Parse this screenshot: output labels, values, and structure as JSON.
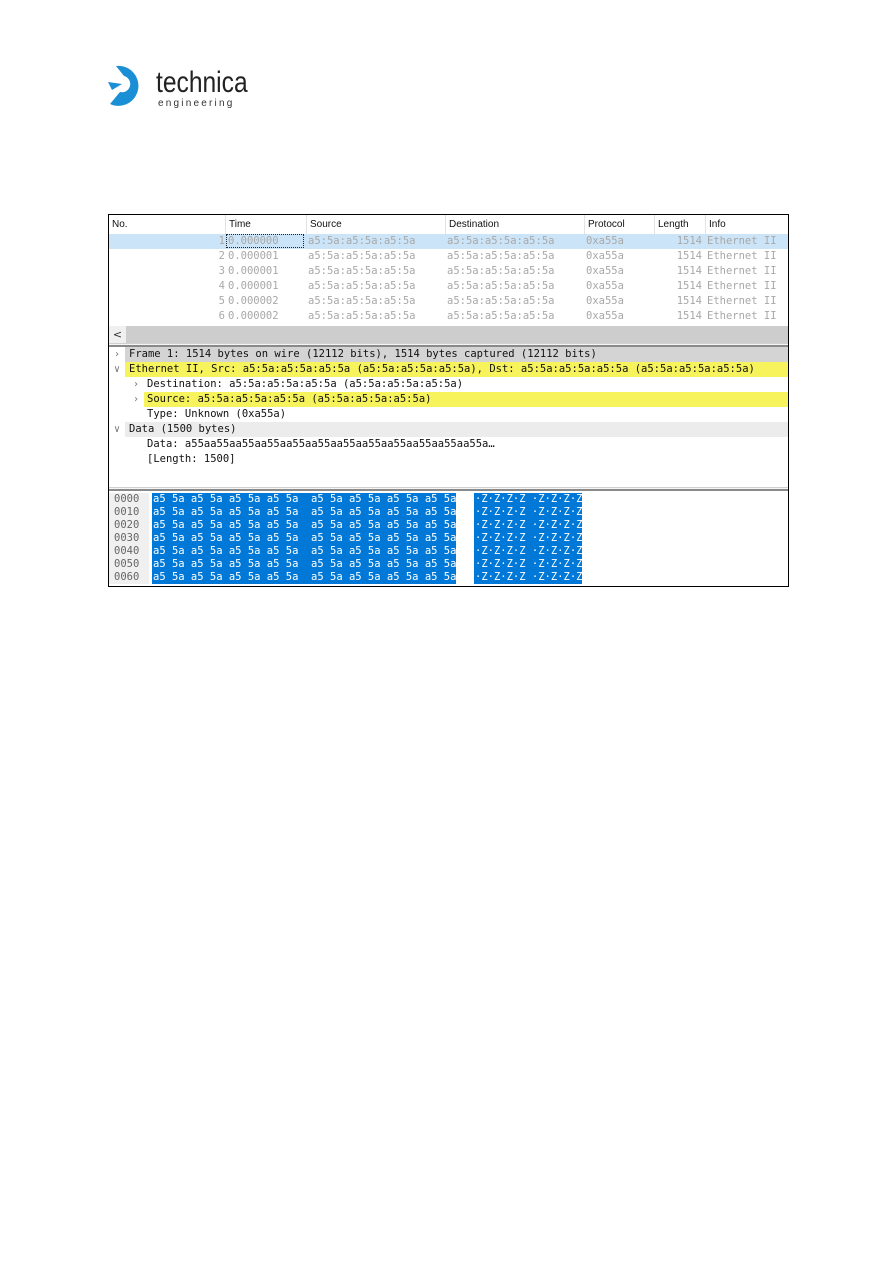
{
  "logo": {
    "word": "technica",
    "sub": "engineering",
    "brand_color": "#1a8fd6"
  },
  "packet_list": {
    "columns": [
      "No.",
      "Time",
      "Source",
      "Destination",
      "Protocol",
      "Length",
      "Info"
    ],
    "rows": [
      {
        "no": "1",
        "time": "0.000000",
        "source": "a5:5a:a5:5a:a5:5a",
        "destination": "a5:5a:a5:5a:a5:5a",
        "protocol": "0xa55a",
        "length": "1514",
        "info": "Ethernet II"
      },
      {
        "no": "2",
        "time": "0.000001",
        "source": "a5:5a:a5:5a:a5:5a",
        "destination": "a5:5a:a5:5a:a5:5a",
        "protocol": "0xa55a",
        "length": "1514",
        "info": "Ethernet II"
      },
      {
        "no": "3",
        "time": "0.000001",
        "source": "a5:5a:a5:5a:a5:5a",
        "destination": "a5:5a:a5:5a:a5:5a",
        "protocol": "0xa55a",
        "length": "1514",
        "info": "Ethernet II"
      },
      {
        "no": "4",
        "time": "0.000001",
        "source": "a5:5a:a5:5a:a5:5a",
        "destination": "a5:5a:a5:5a:a5:5a",
        "protocol": "0xa55a",
        "length": "1514",
        "info": "Ethernet II"
      },
      {
        "no": "5",
        "time": "0.000002",
        "source": "a5:5a:a5:5a:a5:5a",
        "destination": "a5:5a:a5:5a:a5:5a",
        "protocol": "0xa55a",
        "length": "1514",
        "info": "Ethernet II"
      },
      {
        "no": "6",
        "time": "0.000002",
        "source": "a5:5a:a5:5a:a5:5a",
        "destination": "a5:5a:a5:5a:a5:5a",
        "protocol": "0xa55a",
        "length": "1514",
        "info": "Ethernet II"
      }
    ],
    "selected_row": 1,
    "scroll_left_icon": "<"
  },
  "details": {
    "items": [
      {
        "arrow": ">",
        "text": "Frame 1: 1514 bytes on wire (12112 bits), 1514 bytes captured (12112 bits)"
      },
      {
        "arrow": "v",
        "text": "Ethernet II, Src: a5:5a:a5:5a:a5:5a (a5:5a:a5:5a:a5:5a), Dst: a5:5a:a5:5a:a5:5a (a5:5a:a5:5a:a5:5a)"
      },
      {
        "arrow": ">",
        "text": "Destination: a5:5a:a5:5a:a5:5a (a5:5a:a5:5a:a5:5a)"
      },
      {
        "arrow": ">",
        "text": "Source: a5:5a:a5:5a:a5:5a (a5:5a:a5:5a:a5:5a)"
      },
      {
        "arrow": "",
        "text": "Type: Unknown (0xa55a)"
      },
      {
        "arrow": "v",
        "text": "Data (1500 bytes)"
      },
      {
        "arrow": "",
        "text": "Data: a55aa55aa55aa55aa55aa55aa55aa55aa55aa55aa55aa55a…"
      },
      {
        "arrow": "",
        "text": "[Length: 1500]"
      }
    ],
    "highlight_colors": {
      "frame": "#d4d4d4",
      "ethernet": "#f7f35c",
      "source": "#f7f35c",
      "data": "#ececec"
    }
  },
  "bytes": {
    "rows": [
      {
        "offset": "0000",
        "hex": "a5 5a a5 5a a5 5a a5 5a  a5 5a a5 5a a5 5a a5 5a",
        "ascii": "·Z·Z·Z·Z ·Z·Z·Z·Z"
      },
      {
        "offset": "0010",
        "hex": "a5 5a a5 5a a5 5a a5 5a  a5 5a a5 5a a5 5a a5 5a",
        "ascii": "·Z·Z·Z·Z ·Z·Z·Z·Z"
      },
      {
        "offset": "0020",
        "hex": "a5 5a a5 5a a5 5a a5 5a  a5 5a a5 5a a5 5a a5 5a",
        "ascii": "·Z·Z·Z·Z ·Z·Z·Z·Z"
      },
      {
        "offset": "0030",
        "hex": "a5 5a a5 5a a5 5a a5 5a  a5 5a a5 5a a5 5a a5 5a",
        "ascii": "·Z·Z·Z·Z ·Z·Z·Z·Z"
      },
      {
        "offset": "0040",
        "hex": "a5 5a a5 5a a5 5a a5 5a  a5 5a a5 5a a5 5a a5 5a",
        "ascii": "·Z·Z·Z·Z ·Z·Z·Z·Z"
      },
      {
        "offset": "0050",
        "hex": "a5 5a a5 5a a5 5a a5 5a  a5 5a a5 5a a5 5a a5 5a",
        "ascii": "·Z·Z·Z·Z ·Z·Z·Z·Z"
      },
      {
        "offset": "0060",
        "hex": "a5 5a a5 5a a5 5a a5 5a  a5 5a a5 5a a5 5a a5 5a",
        "ascii": "·Z·Z·Z·Z ·Z·Z·Z·Z"
      }
    ],
    "selection_color": "#0078d7"
  }
}
